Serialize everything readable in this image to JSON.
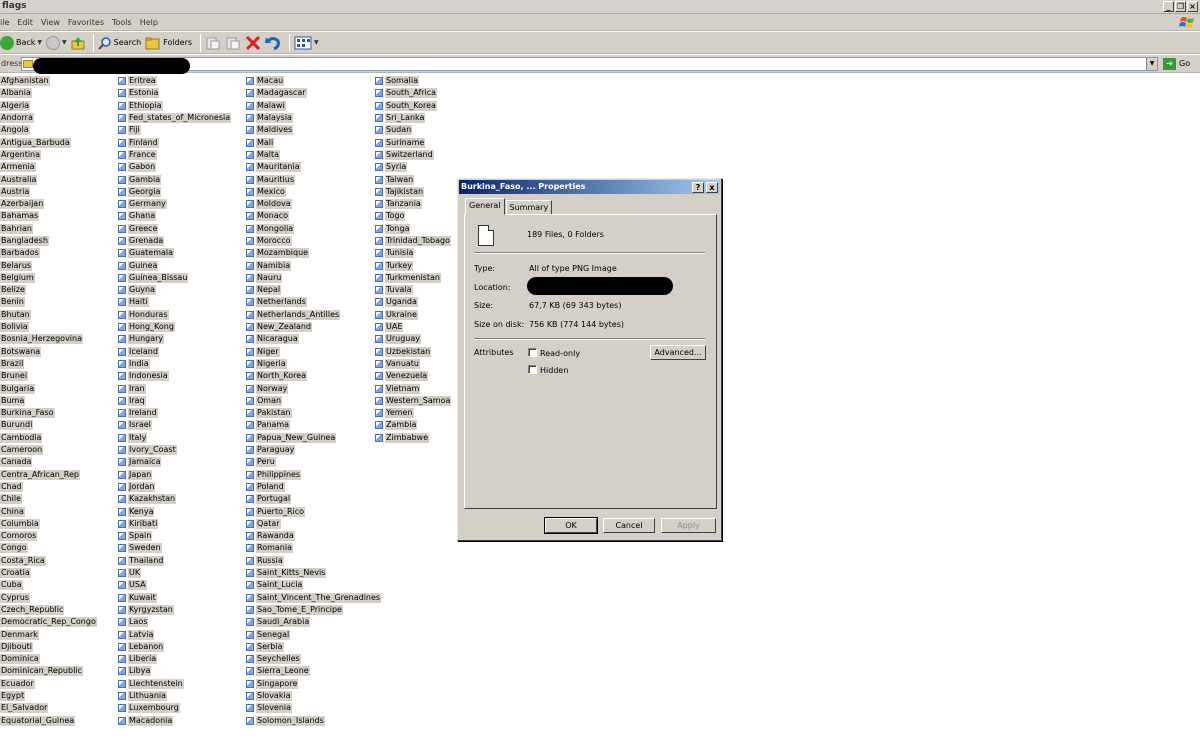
{
  "window": {
    "title": "flags"
  },
  "menu": [
    "ile",
    "Edit",
    "View",
    "Favorites",
    "Tools",
    "Help"
  ],
  "toolbar": {
    "back_label": "Back",
    "search_label": "Search",
    "folders_label": "Folders"
  },
  "address": {
    "label": "dress",
    "go_label": "Go"
  },
  "files": {
    "col1": [
      "Afghanistan",
      "Albania",
      "Algeria",
      "Andorra",
      "Angola",
      "Antigua_Barbuda",
      "Argentina",
      "Armenia",
      "Australia",
      "Austria",
      "Azerbaijan",
      "Bahamas",
      "Bahrian",
      "Bangladesh",
      "Barbados",
      "Belarus",
      "Belgium",
      "Belize",
      "Benin",
      "Bhutan",
      "Bolivia",
      "Bosnia_Herzegovina",
      "Botswana",
      "Brazil",
      "Brunei",
      "Bulgaria",
      "Buma",
      "Burkina_Faso",
      "Burundi",
      "Cambodia",
      "Cameroon",
      "Canada",
      "Centra_African_Rep",
      "Chad",
      "Chile",
      "China",
      "Columbia",
      "Comoros",
      "Congo",
      "Costa_Rica",
      "Croatia",
      "Cuba",
      "Cyprus",
      "Czech_Republic",
      "Democratic_Rep_Congo",
      "Denmark",
      "Djibouti",
      "Dominica",
      "Dominican_Republic",
      "Ecuador",
      "Egypt",
      "El_Salvador",
      "Equatorial_Guinea"
    ],
    "col2": [
      "Eritrea",
      "Estonia",
      "Ethiopia",
      "Fed_states_of_Micronesia",
      "Fiji",
      "Finland",
      "France",
      "Gabon",
      "Gambia",
      "Georgia",
      "Germany",
      "Ghana",
      "Greece",
      "Grenada",
      "Guatemala",
      "Guinea",
      "Guinea_Bissau",
      "Guyna",
      "Haiti",
      "Honduras",
      "Hong_Kong",
      "Hungary",
      "Iceland",
      "India",
      "Indonesia",
      "Iran",
      "Iraq",
      "Ireland",
      "Israel",
      "Italy",
      "Ivory_Coast",
      "Jamaica",
      "Japan",
      "Jordan",
      "Kazakhstan",
      "Kenya",
      "Kiribati",
      "Spain",
      "Sweden",
      "Thailand",
      "UK",
      "USA",
      "Kuwait",
      "Kyrgyzstan",
      "Laos",
      "Latvia",
      "Lebanon",
      "Liberia",
      "Libya",
      "Liechtenstein",
      "Lithuania",
      "Luxembourg",
      "Macadonia"
    ],
    "col3": [
      "Macau",
      "Madagascar",
      "Malawi",
      "Malaysia",
      "Maldives",
      "Mali",
      "Malta",
      "Mauritania",
      "Mauritius",
      "Mexico",
      "Moldova",
      "Monaco",
      "Mongolia",
      "Morocco",
      "Mozambique",
      "Namibia",
      "Nauru",
      "Nepal",
      "Netherlands",
      "Netherlands_Antilles",
      "New_Zealand",
      "Nicaragua",
      "Niger",
      "Nigeria",
      "North_Korea",
      "Norway",
      "Oman",
      "Pakistan",
      "Panama",
      "Papua_New_Guinea",
      "Paraguay",
      "Peru",
      "Philippines",
      "Poland",
      "Portugal",
      "Puerto_Rico",
      "Qatar",
      "Rawanda",
      "Romania",
      "Russia",
      "Saint_Kitts_Nevis",
      "Saint_Lucia",
      "Saint_Vincent_The_Grenadines",
      "Sao_Tome_E_Principe",
      "Saudi_Arabia",
      "Senegal",
      "Serbia",
      "Seychelles",
      "Sierra_Leone",
      "Singapore",
      "Slovakia",
      "Slovenia",
      "Solomon_Islands"
    ],
    "col4": [
      "Somalia",
      "South_Africa",
      "South_Korea",
      "Sri_Lanka",
      "Sudan",
      "Suriname",
      "Switzerland",
      "Syria",
      "Taiwan",
      "Tajikistan",
      "Tanzania",
      "Togo",
      "Tonga",
      "Trinidad_Tobago",
      "Tunisia",
      "Turkey",
      "Turkmenistan",
      "Tuvala",
      "Uganda",
      "Ukraine",
      "UAE",
      "Uruguay",
      "Uzbekistan",
      "Vanuatu",
      "Venezuela",
      "Vietnam",
      "Western_Samoa",
      "Yemen",
      "Zambia",
      "Zimbabwe"
    ]
  },
  "dialog": {
    "title": "Burkina_Faso, ... Properties",
    "help": "?",
    "close": "x",
    "tabs": [
      "General",
      "Summary"
    ],
    "summary": "189 Files, 0 Folders",
    "type_label": "Type:",
    "type_value": "All of type PNG Image",
    "location_label": "Location:",
    "size_label": "Size:",
    "size_value": "67,7 KB (69 343 bytes)",
    "size_disk_label": "Size on disk:",
    "size_disk_value": "756 KB (774 144 bytes)",
    "attributes_label": "Attributes",
    "readonly_label": "Read-only",
    "hidden_label": "Hidden",
    "advanced_label": "Advanced...",
    "ok_label": "OK",
    "cancel_label": "Cancel",
    "apply_label": "Apply"
  }
}
